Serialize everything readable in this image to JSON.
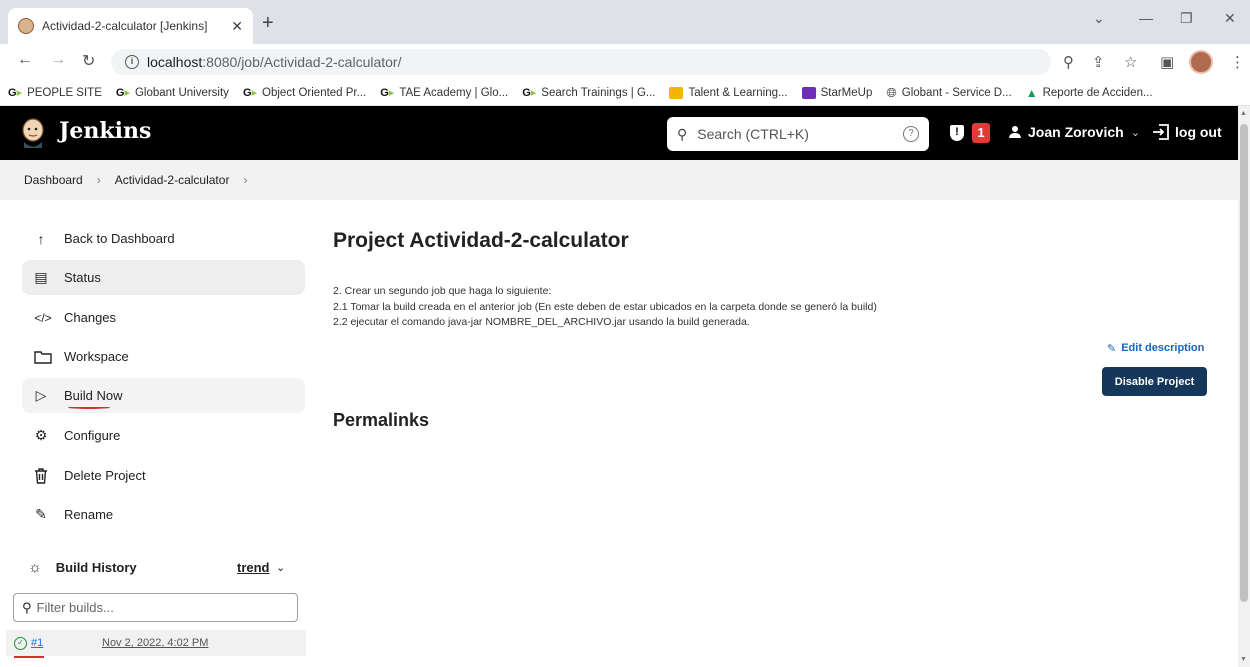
{
  "browser": {
    "tab_title": "Actividad-2-calculator [Jenkins]",
    "tab_close": "✕",
    "new_tab": "+",
    "url_host": "localhost",
    "url_path": ":8080/job/Actividad-2-calculator/",
    "bookmarks": [
      {
        "label": "PEOPLE SITE",
        "icon": "g-icon"
      },
      {
        "label": "Globant University",
        "icon": "g-icon"
      },
      {
        "label": "Object Oriented Pr...",
        "icon": "g-icon"
      },
      {
        "label": "TAE Academy | Glo...",
        "icon": "g-icon"
      },
      {
        "label": "Search Trainings | G...",
        "icon": "g-icon"
      },
      {
        "label": "Talent & Learning...",
        "icon": "slides-icon",
        "color": "#f4b400"
      },
      {
        "label": "StarMeUp",
        "icon": "starmeup-icon",
        "color": "#6f2dbd"
      },
      {
        "label": "Globant - Service D...",
        "icon": "globe-icon"
      },
      {
        "label": "Reporte de Acciden...",
        "icon": "drive-icon"
      }
    ]
  },
  "jenkins": {
    "brand": "Jenkins",
    "search_placeholder": "Search (CTRL+K)",
    "security_count": "1",
    "user": "Joan Zorovich",
    "logout": "log out"
  },
  "breadcrumb": [
    "Dashboard",
    "Actividad-2-calculator"
  ],
  "sidebar": {
    "items": [
      {
        "label": "Back to Dashboard",
        "icon": "arrow-up-icon"
      },
      {
        "label": "Status",
        "icon": "document-icon"
      },
      {
        "label": "Changes",
        "icon": "code-icon"
      },
      {
        "label": "Workspace",
        "icon": "folder-icon"
      },
      {
        "label": "Build Now",
        "icon": "play-icon"
      },
      {
        "label": "Configure",
        "icon": "gear-icon"
      },
      {
        "label": "Delete Project",
        "icon": "trash-icon"
      },
      {
        "label": "Rename",
        "icon": "pencil-icon"
      }
    ]
  },
  "build_history": {
    "title": "Build History",
    "trend": "trend",
    "filter_placeholder": "Filter builds...",
    "builds": [
      {
        "number": "#1",
        "date": "Nov 2, 2022, 4:02 PM",
        "status": "success"
      }
    ]
  },
  "main": {
    "title": "Project Actividad-2-calculator",
    "description": [
      "2. Crear un segundo job que haga lo siguiente:",
      "2.1 Tomar la build creada en el anterior job (En este deben de estar ubicados en la carpeta donde se generó la build)",
      "2.2 ejecutar el comando java-jar NOMBRE_DEL_ARCHIVO.jar usando la build generada."
    ],
    "edit_description": "Edit description",
    "disable_project": "Disable Project",
    "permalinks": "Permalinks"
  },
  "colors": {
    "jenkins_header": "#000000",
    "primary_button": "#14375a",
    "badge": "#e53935",
    "link": "#1565c0"
  }
}
